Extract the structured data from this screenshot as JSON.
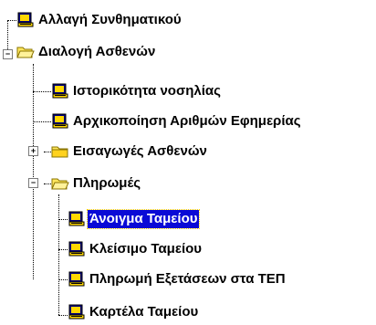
{
  "tree": {
    "items": [
      {
        "label": "Αλλαγή Συνθηματικού",
        "icon": "computer-icon"
      },
      {
        "label": "Διαλογή Ασθενών",
        "icon": "folder-open-icon",
        "expanded": true
      },
      {
        "label": "Ιστορικότητα νοσηλίας",
        "icon": "computer-icon"
      },
      {
        "label": "Αρχικοποίηση Αριθμών Εφημερίας",
        "icon": "computer-icon"
      },
      {
        "label": "Εισαγωγές Ασθενών",
        "icon": "folder-closed-icon",
        "expanded": false
      },
      {
        "label": "Πληρωμές",
        "icon": "folder-open-icon",
        "expanded": true
      },
      {
        "label": "Άνοιγμα Ταμείου",
        "icon": "computer-icon",
        "selected": true
      },
      {
        "label": "Κλείσιμο Ταμείου",
        "icon": "computer-icon"
      },
      {
        "label": "Πληρωμή Εξετάσεων στα ΤΕΠ",
        "icon": "computer-icon"
      },
      {
        "label": "Καρτέλα Ταμείου",
        "icon": "computer-icon"
      }
    ],
    "expander_symbols": {
      "expanded": "−",
      "collapsed": "+"
    }
  }
}
